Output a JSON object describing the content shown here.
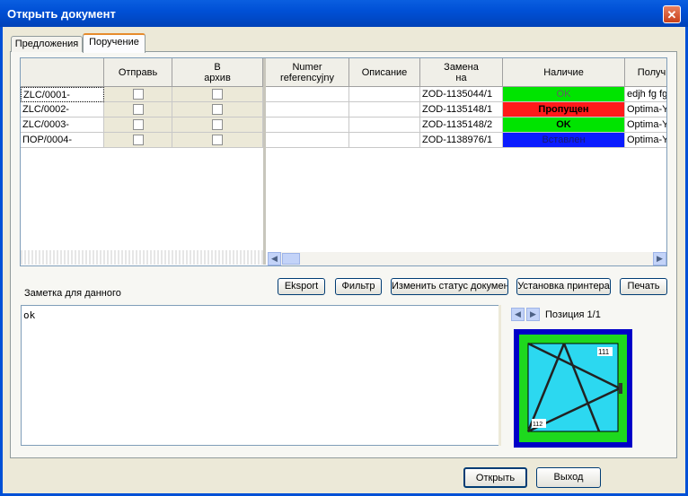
{
  "window": {
    "title": "Открыть документ",
    "close_glyph": "✕"
  },
  "tabs": [
    {
      "label": "Предложения"
    },
    {
      "label": "Поручение"
    }
  ],
  "grid": {
    "headers": {
      "col0": "",
      "send": "Отправь",
      "archive": "В\nархив",
      "ref": "Numer\nreferencyjny",
      "desc": "Описание",
      "replace": "Замена\nна",
      "avail": "Наличие",
      "recv": "Получ"
    },
    "rows": [
      {
        "id": "ZLC/0001-",
        "ref": "",
        "desc": "",
        "replace": "ZOD-1135044/1",
        "avail": "OK",
        "avail_color": "#00E400",
        "avail_text_color": "#606060",
        "avail_bold": false,
        "recv": "edjh fg fg"
      },
      {
        "id": "ZLC/0002-",
        "ref": "",
        "desc": "",
        "replace": "ZOD-1135148/1",
        "avail": "Пропущен",
        "avail_color": "#FF1A1A",
        "avail_text_color": "#000000",
        "avail_bold": true,
        "recv": "Optima-Y"
      },
      {
        "id": "ZLC/0003-",
        "ref": "",
        "desc": "",
        "replace": "ZOD-1135148/2",
        "avail": "OK",
        "avail_color": "#00E400",
        "avail_text_color": "#000000",
        "avail_bold": true,
        "recv": "Optima-Y"
      },
      {
        "id": "ПОР/0004-",
        "ref": "",
        "desc": "",
        "replace": "ZOD-1138976/1",
        "avail": "Вставлен",
        "avail_color": "#0A1CFF",
        "avail_text_color": "#1A1A6A",
        "avail_bold": false,
        "recv": "Optima-Y"
      }
    ]
  },
  "toolbar": {
    "export": "Eksport",
    "filter": "Фильтр",
    "change_status": "Изменить статус документ",
    "printer_setup": "Установка принтера",
    "print": "Печать"
  },
  "note": {
    "label": "Заметка для данного",
    "value": "ok"
  },
  "position": {
    "label": "Позиция 1/1"
  },
  "preview": {
    "label_top": "111",
    "label_bottom": "112"
  },
  "footer": {
    "open": "Открыть",
    "exit": "Выход"
  }
}
